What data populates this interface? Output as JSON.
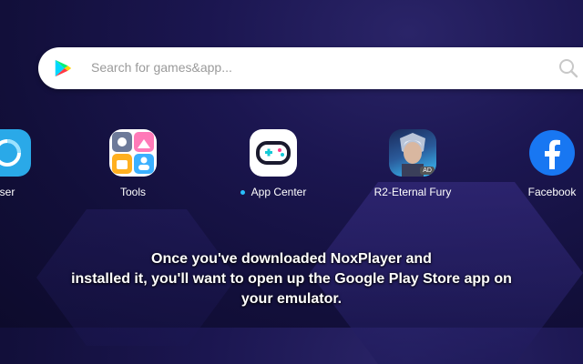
{
  "search": {
    "placeholder": "Search for games&app..."
  },
  "apps": [
    {
      "label": "ser",
      "icon": "browser-icon"
    },
    {
      "label": "Tools",
      "icon": "tools-icon"
    },
    {
      "label": "App Center",
      "icon": "app-center-icon"
    },
    {
      "label": "R2-Eternal Fury",
      "icon": "game-icon",
      "badge": "AD"
    },
    {
      "label": "Facebook",
      "icon": "facebook-icon"
    }
  ],
  "caption": {
    "line1": "Once you've downloaded NoxPlayer and",
    "line2": "installed it, you'll want to open up the Google Play Store app on",
    "line3": "your emulator."
  },
  "colors": {
    "accent": "#29c0ff",
    "background": "#1b1650",
    "facebook": "#1877f2"
  }
}
